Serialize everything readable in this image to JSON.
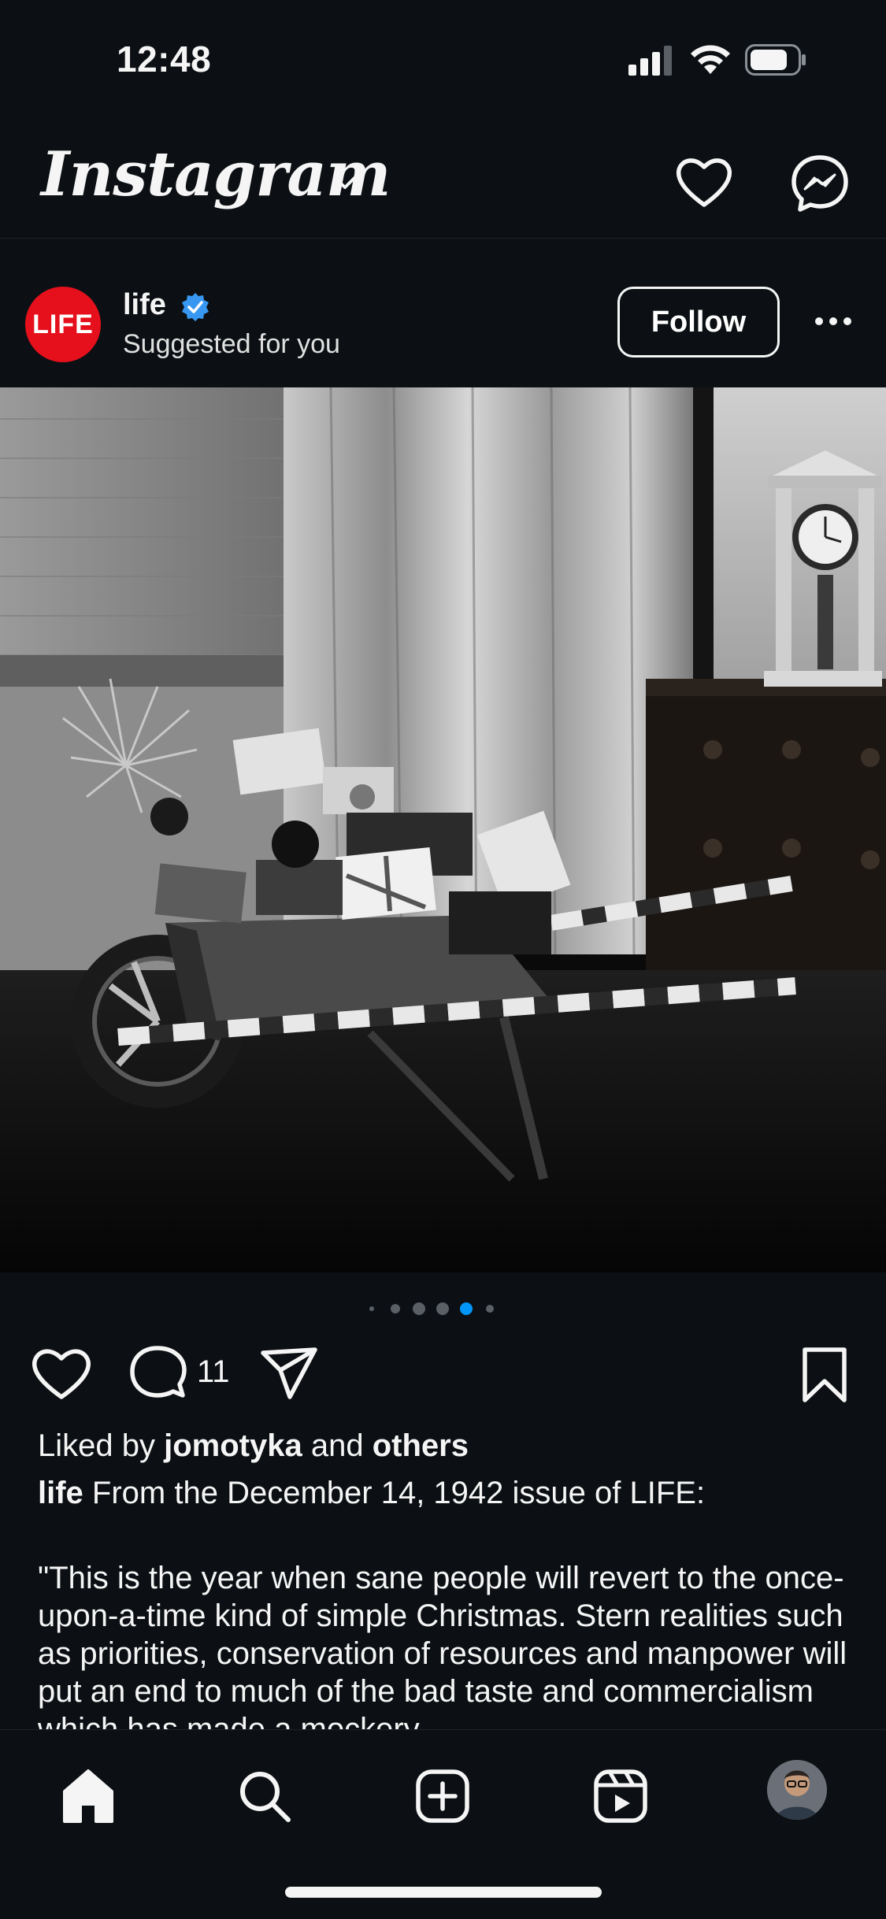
{
  "status_bar": {
    "time": "12:48"
  },
  "header": {
    "logo": "Instagram"
  },
  "post": {
    "username": "life",
    "avatar_text": "LIFE",
    "subtitle": "Suggested for you",
    "follow_label": "Follow",
    "carousel": {
      "dots": 6,
      "active_index": 4
    },
    "comment_count": "11",
    "liked_by_prefix": "Liked by",
    "liked_by_user": "jomotyka",
    "liked_by_and": "and",
    "liked_by_others": "others",
    "caption_user": "life",
    "caption_first_line": "From the December 14, 1942 issue of LIFE:",
    "caption_body": "\"This is the year when sane people will revert to the once-upon-a-time kind of simple Christmas. Stern realities such as priorities, conservation of resources and manpower will put an end to much of the bad taste and commercialism which has made a mockery"
  },
  "colors": {
    "background": "#0c1014",
    "text": "#f5f5f5",
    "verified": "#3897f0",
    "life_red": "#e5101b",
    "active_dot": "#0095f6"
  },
  "icons": [
    "chevron-down-icon",
    "heart-icon",
    "messenger-icon",
    "verified-badge-icon",
    "more-icon",
    "comment-icon",
    "share-icon",
    "bookmark-icon",
    "home-icon",
    "search-icon",
    "create-icon",
    "reels-icon"
  ]
}
